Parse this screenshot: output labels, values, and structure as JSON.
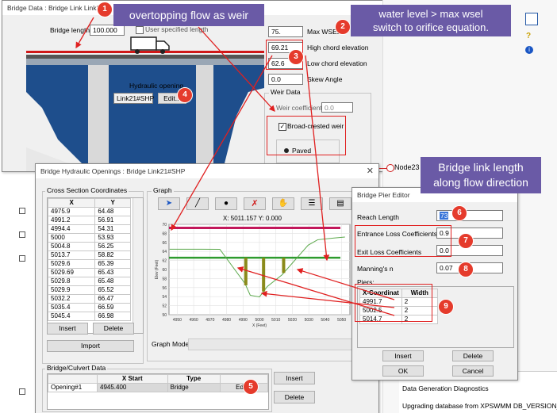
{
  "main_window": {
    "title": "Bridge Data : Bridge Link Link21",
    "bridge_length_label": "Bridge length",
    "bridge_length_value": "100.000",
    "user_specified_length_label": "User specified length",
    "max_wsel_value": "75.",
    "max_wsel_label": "Max WSEL",
    "high_chord_value": "69.21",
    "high_chord_label": "High chord elevation",
    "low_chord_value": "62.6",
    "low_chord_label": "Low chord elevation",
    "skew_value": "0.0",
    "skew_label": "Skew Angle",
    "hydraulic_opening_label": "Hydraulic opening",
    "hydraulic_opening_value": "Link21#SHP",
    "edit_label": "Edit...",
    "weir_data_label": "Weir Data",
    "weir_coefficient_label": "Weir coefficient",
    "weir_coefficient_value": "0.0",
    "broad_crested_label": "Broad-crested weir",
    "paved_label": "Paved"
  },
  "right_panel": {
    "node_label": "Node23",
    "diag_line1": "Data Generation Diagnostics",
    "diag_line2": "Upgrading database from XPSWMM DB_VERSION_1"
  },
  "openings_window": {
    "title": "Bridge Hydraulic Openings : Bridge Link21#SHP",
    "xs_group_label": "Cross Section Coordinates",
    "xs_columns": [
      "X",
      "Y"
    ],
    "xs_rows": [
      [
        "4975.9",
        "64.48"
      ],
      [
        "4991.2",
        "56.91"
      ],
      [
        "4994.4",
        "54.31"
      ],
      [
        "5000",
        "53.93"
      ],
      [
        "5004.8",
        "56.25"
      ],
      [
        "5013.7",
        "58.82"
      ],
      [
        "5029.6",
        "65.39"
      ],
      [
        "5029.69",
        "65.43"
      ],
      [
        "5029.8",
        "65.48"
      ],
      [
        "5029.9",
        "65.52"
      ],
      [
        "5032.2",
        "66.47"
      ],
      [
        "5035.4",
        "66.59"
      ],
      [
        "5045.4",
        "66.98"
      ]
    ],
    "insert_label": "Insert",
    "delete_label": "Delete",
    "import_label": "Import",
    "graph_group_label": "Graph",
    "graph_coords_text": "X: 5011.157 Y: 0.000",
    "graph_mode_label": "Graph Mode",
    "culvert_group_label": "Bridge/Culvert Data",
    "culvert_columns": [
      "",
      "X Start",
      "Type",
      ""
    ],
    "culvert_row": [
      "Opening#1",
      "4945.400",
      "Bridge",
      "Edit..."
    ],
    "culvert_insert_label": "Insert",
    "culvert_delete_label": "Delete"
  },
  "pier_editor": {
    "title": "Bridge Pier Editor",
    "reach_length_label": "Reach Length",
    "reach_length_value": "73",
    "entrance_loss_label": "Entrance Loss Coefficients",
    "entrance_loss_value": "0.9",
    "exit_loss_label": "Exit Loss Coefficients",
    "exit_loss_value": "0.0",
    "mannings_label": "Manning's n",
    "mannings_value": "0.07",
    "piers_label": "Piers:",
    "pier_columns": [
      "X-Coordinat",
      "Width"
    ],
    "pier_rows": [
      [
        "4991.7",
        "2"
      ],
      [
        "5002.5",
        "2"
      ],
      [
        "5014.7",
        "2"
      ]
    ],
    "insert_label": "Insert",
    "delete_label": "Delete",
    "ok_label": "OK",
    "cancel_label": "Cancel"
  },
  "chart_data": {
    "type": "line",
    "xlabel": "X (Feet)",
    "ylabel": "Elev (Feet)",
    "xlim": [
      4945,
      5055
    ],
    "ylim": [
      50,
      70
    ],
    "x_ticks": [
      "4950",
      "4960",
      "4970",
      "4980",
      "4990",
      "5000",
      "5010",
      "5020",
      "5030",
      "5040",
      "5050"
    ],
    "y_ticks": [
      "70",
      "68",
      "66",
      "64",
      "62",
      "60",
      "58",
      "56",
      "54",
      "52",
      "50"
    ],
    "ground_profile": {
      "x": [
        4945.4,
        4975.9,
        4991.2,
        4994.4,
        5000,
        5004.8,
        5013.7,
        5029.6,
        5035.4,
        5045.4,
        5052
      ],
      "y": [
        64.5,
        64.48,
        56.91,
        54.31,
        53.93,
        56.25,
        58.82,
        65.39,
        66.59,
        66.98,
        67.2
      ]
    },
    "high_chord": 69.21,
    "low_chord": 62.6,
    "piers_x": [
      4991.7,
      5002.5,
      5014.7
    ]
  },
  "callouts": {
    "c1": "overtopping flow as weir",
    "c2_line1": "water level > max wsel",
    "c2_line2": "switch to orifice equation.",
    "c3_line1": "Bridge link length",
    "c3_line2": "along flow direction"
  },
  "numbers": [
    "1",
    "2",
    "3",
    "4",
    "5",
    "6",
    "7",
    "8",
    "9"
  ],
  "colors": {
    "callout_bg": "#6a5aa6",
    "marker_red": "#e53b2c",
    "ground_line": "#5aa84a",
    "chord_line_high": "#c2185b",
    "chord_line_low": "#2e9b2e",
    "pier_fill": "#8a8a1a"
  }
}
